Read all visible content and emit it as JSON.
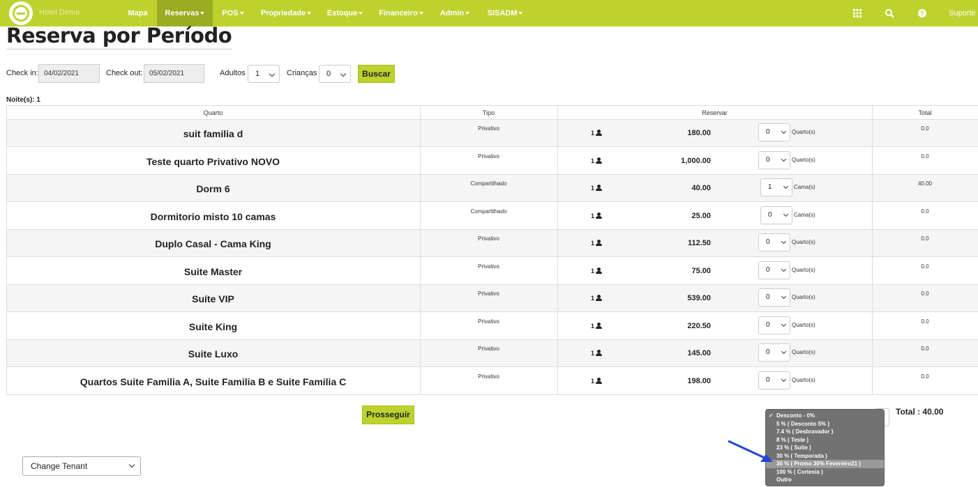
{
  "navbar": {
    "brand": "Hotel Demo",
    "items": [
      {
        "label": "Mapa",
        "dropdown": false,
        "active": false
      },
      {
        "label": "Reservas",
        "dropdown": true,
        "active": true
      },
      {
        "label": "POS",
        "dropdown": true,
        "active": false
      },
      {
        "label": "Propriedade",
        "dropdown": true,
        "active": false
      },
      {
        "label": "Estoque",
        "dropdown": true,
        "active": false
      },
      {
        "label": "Financeiro",
        "dropdown": true,
        "active": false
      },
      {
        "label": "Admin",
        "dropdown": true,
        "active": false
      },
      {
        "label": "SISADM",
        "dropdown": true,
        "active": false
      }
    ],
    "icons": [
      "grid-icon",
      "search-icon",
      "help-icon"
    ],
    "suporte": "Suporte",
    "accent": "#bdd22e"
  },
  "page": {
    "title": "Reserva por Período"
  },
  "search": {
    "checkin_label": "Check in:",
    "checkin_value": "04/02/2021",
    "checkout_label": "Check out:",
    "checkout_value": "05/02/2021",
    "adultos_label": "Adultos",
    "adultos_value": "1",
    "criancas_label": "Crianças",
    "criancas_value": "0",
    "buscar_label": "Buscar"
  },
  "noites": "Noite(s): 1",
  "table": {
    "headers": {
      "quarto": "Quarto",
      "tipo": "Tipo",
      "reservar": "Reservar",
      "total": "Total"
    },
    "rows": [
      {
        "name": "suit familia d",
        "tipo": "Privativo",
        "pax": "1",
        "price": "180.00",
        "qty": "0",
        "unit": "Quarto(s)",
        "total": "0.0"
      },
      {
        "name": "Teste quarto Privativo NOVO",
        "tipo": "Privativo",
        "pax": "1",
        "price": "1,000.00",
        "qty": "0",
        "unit": "Quarto(s)",
        "total": "0.0"
      },
      {
        "name": "Dorm 6",
        "tipo": "Compartilhado",
        "pax": "1",
        "price": "40.00",
        "qty": "1",
        "unit": "Cama(s)",
        "total": "40.00"
      },
      {
        "name": "Dormitorio misto 10 camas",
        "tipo": "Compartilhado",
        "pax": "1",
        "price": "25.00",
        "qty": "0",
        "unit": "Cama(s)",
        "total": "0.0"
      },
      {
        "name": "Duplo Casal - Cama King",
        "tipo": "Privativo",
        "pax": "1",
        "price": "112.50",
        "qty": "0",
        "unit": "Quarto(s)",
        "total": "0.0"
      },
      {
        "name": "Suite Master",
        "tipo": "Privativo",
        "pax": "1",
        "price": "75.00",
        "qty": "0",
        "unit": "Quarto(s)",
        "total": "0.0"
      },
      {
        "name": "Suíte VIP",
        "tipo": "Privativo",
        "pax": "1",
        "price": "539.00",
        "qty": "0",
        "unit": "Quarto(s)",
        "total": "0.0"
      },
      {
        "name": "Suite King",
        "tipo": "Privativo",
        "pax": "1",
        "price": "220.50",
        "qty": "0",
        "unit": "Quarto(s)",
        "total": "0.0"
      },
      {
        "name": "Suite Luxo",
        "tipo": "Privativo",
        "pax": "1",
        "price": "145.00",
        "qty": "0",
        "unit": "Quarto(s)",
        "total": "0.0"
      },
      {
        "name": "Quartos Suite Familia A, Suite Familia B e Suite Familia C",
        "tipo": "Privativo",
        "pax": "1",
        "price": "198.00",
        "qty": "0",
        "unit": "Quarto(s)",
        "total": "0.0"
      }
    ]
  },
  "prosseguir_label": "Prosseguir",
  "total_label": "Total : 40.00",
  "discount": {
    "selected_index": 0,
    "highlighted_index": 6,
    "options": [
      "Desconto - 0%",
      "5 % ( Desconto 5% )",
      "7.4 % ( Desbravador )",
      "8 % ( Teste )",
      "23 % ( Suite )",
      "30 % ( Temporada )",
      "30 % ( Promo 30% Fevereiro21 )",
      "100 % ( Cortesia )",
      "Outro"
    ]
  },
  "tenant": {
    "label": "Change Tenant"
  }
}
